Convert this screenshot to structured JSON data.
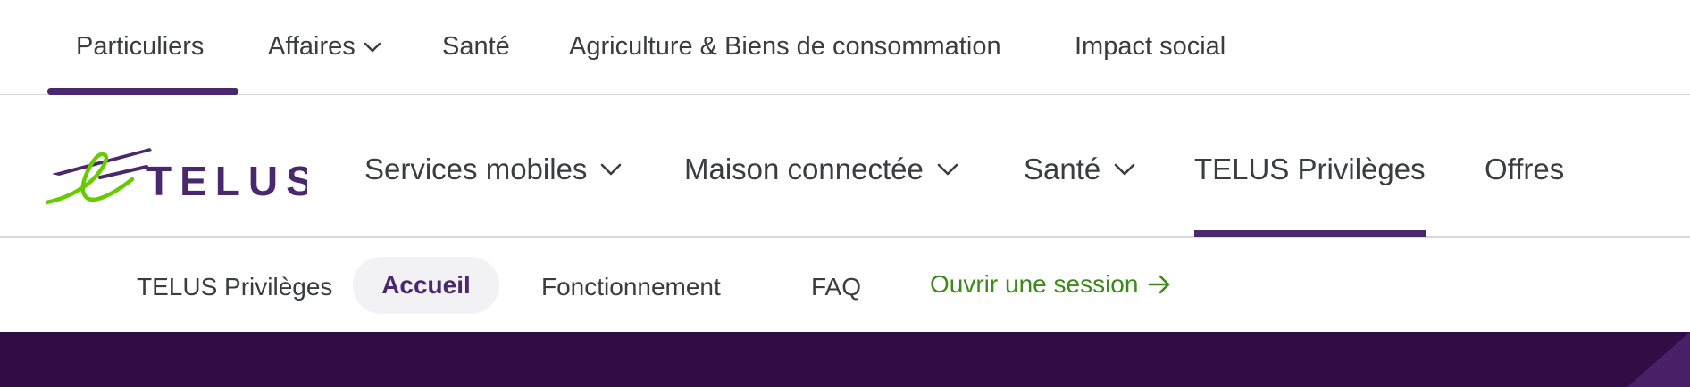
{
  "top_nav": {
    "items": [
      {
        "label": "Particuliers",
        "active": true,
        "has_menu": false
      },
      {
        "label": "Affaires",
        "active": false,
        "has_menu": true
      },
      {
        "label": "Santé",
        "active": false,
        "has_menu": false
      },
      {
        "label": "Agriculture & Biens de consommation",
        "active": false,
        "has_menu": false
      },
      {
        "label": "Impact social",
        "active": false,
        "has_menu": false
      }
    ]
  },
  "logo": {
    "text": "TELUS",
    "icon": "telus-logo-icon"
  },
  "main_nav": {
    "items": [
      {
        "label": "Services mobiles",
        "has_menu": true,
        "active": false
      },
      {
        "label": "Maison connectée",
        "has_menu": true,
        "active": false
      },
      {
        "label": "Santé",
        "has_menu": true,
        "active": false
      },
      {
        "label": "TELUS Privilèges",
        "has_menu": false,
        "active": true
      },
      {
        "label": "Offres",
        "has_menu": false,
        "active": false
      }
    ]
  },
  "sub_nav": {
    "title": "TELUS Privilèges",
    "items": [
      {
        "label": "Accueil",
        "active": true
      },
      {
        "label": "Fonctionnement",
        "active": false
      },
      {
        "label": "FAQ",
        "active": false
      }
    ],
    "login": {
      "label": "Ouvrir une session",
      "icon": "arrow-right-icon"
    }
  },
  "colors": {
    "brand_purple": "#4b286d",
    "banner_purple": "#310c45",
    "brand_green": "#66cc00",
    "link_green": "#3b8a1a"
  }
}
